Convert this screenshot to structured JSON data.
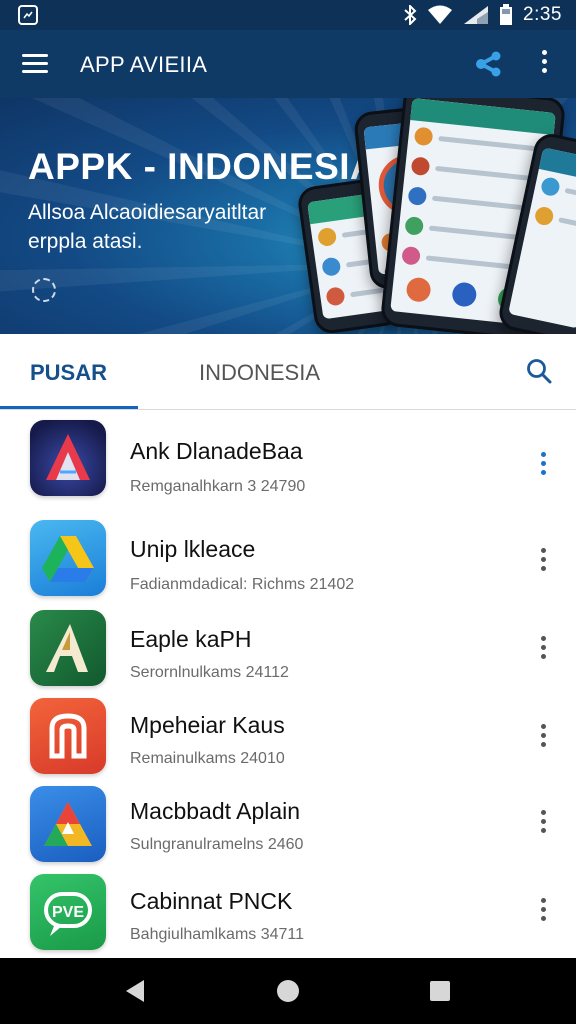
{
  "status_bar": {
    "time": "2:35",
    "icons": [
      "photo-icon",
      "bluetooth-icon",
      "wifi-icon",
      "signal-icon",
      "battery-icon"
    ]
  },
  "app_bar": {
    "title": "APP AVIEIIA",
    "icons": [
      "menu-icon",
      "share-icon",
      "more-vert-icon"
    ]
  },
  "hero": {
    "title": "APPK - INDONESIA",
    "subtitle_line1": "Allsoa Alcaoidiesaryaitltar",
    "subtitle_line2": "erppla atasi."
  },
  "tabs": {
    "active": "PUSAR",
    "inactive": "INDONESIA",
    "accent_color": "#1565c0"
  },
  "apps": [
    {
      "name": "Ank DlanadeBaa",
      "meta": "Remganalhkarn 3 24790",
      "icon": "red-blue-a-icon"
    },
    {
      "name": "Unip lkleace",
      "meta": "Fadianmdadical: Richms 21402",
      "icon": "drive-icon"
    },
    {
      "name": "Eaple kaPH",
      "meta": "Serornlnulkams 24112",
      "icon": "green-a-icon"
    },
    {
      "name": "Mpeheiar Kaus",
      "meta": "Remainulkams 24010",
      "icon": "orange-n-icon"
    },
    {
      "name": "Macbbadt Aplain",
      "meta": "Sulngranulramelns 2460",
      "icon": "blue-a-icon"
    },
    {
      "name": "Cabinnat PNCK",
      "meta": "Bahgiulhamlkams 34711",
      "icon": "green-chat-icon"
    }
  ],
  "nav_bar": {
    "icons": [
      "back-icon",
      "home-icon",
      "recent-apps-icon"
    ]
  }
}
